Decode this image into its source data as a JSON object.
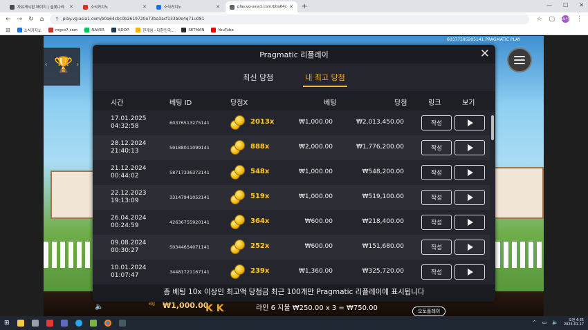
{
  "browser": {
    "tabs": [
      {
        "title": "자유게시판 페이지 | 슬롯나라",
        "color": "#4a4a4a",
        "active": false
      },
      {
        "title": "소식카지노",
        "color": "#d93025",
        "active": false
      },
      {
        "title": "소식카지노",
        "color": "#1a73e8",
        "active": false
      },
      {
        "title": "play.vg-asia1.com/b0a64c",
        "color": "#5f6368",
        "active": true
      }
    ],
    "new_tab": "+",
    "url": "play.vg-asia1.com/b0a64cbc0b2619720e73ba3acf133b0e4q71u081",
    "profile": "소식",
    "bookmarks": [
      {
        "label": "소식카지노",
        "color": "#1a73e8"
      },
      {
        "label": "mgco7.com",
        "color": "#c0392b"
      },
      {
        "label": "NAVER",
        "color": "#03c75a"
      },
      {
        "label": "SDOP",
        "color": "#1b3a57"
      },
      {
        "label": "한게임 - 대한민국...",
        "color": "#f4b400"
      },
      {
        "label": "SETMAN",
        "color": "#2d2d2d"
      },
      {
        "label": "YouTube",
        "color": "#ff0000"
      }
    ]
  },
  "game": {
    "id_text": "60377595205141  PRAGMATIC PLAY",
    "bet_label": "베팅",
    "bet_value": "₩1,000.00",
    "kk": "K K",
    "line_info": "라인 6 지불 ₩250.00 x 3 = ₩750.00",
    "autoplay": "오토플레이"
  },
  "panel": {
    "title": "Pragmatic 리플레이",
    "close": "✕",
    "tabs": [
      {
        "label": "최신 당첨",
        "active": false
      },
      {
        "label": "내 최고 당첨",
        "active": true
      }
    ],
    "columns": {
      "time": "시간",
      "bet_id": "베팅 ID",
      "multiplier": "당첨X",
      "bet": "베팅",
      "win": "당첨",
      "link": "링크",
      "view": "보기"
    },
    "rows": [
      {
        "date": "17.01.2025",
        "time": "04:32:58",
        "bet_id": "60376513275141",
        "multiplier": "2013x",
        "bet": "₩1,000.00",
        "win": "₩2,013,450.00",
        "link_label": "작성"
      },
      {
        "date": "28.12.2024",
        "time": "21:40:13",
        "bet_id": "59188011099141",
        "multiplier": "888x",
        "bet": "₩2,000.00",
        "win": "₩1,776,200.00",
        "link_label": "작성"
      },
      {
        "date": "21.12.2024",
        "time": "00:44:02",
        "bet_id": "58717336372141",
        "multiplier": "548x",
        "bet": "₩1,000.00",
        "win": "₩548,200.00",
        "link_label": "작성"
      },
      {
        "date": "22.12.2023",
        "time": "19:13:09",
        "bet_id": "33147941052141",
        "multiplier": "519x",
        "bet": "₩1,000.00",
        "win": "₩519,100.00",
        "link_label": "작성"
      },
      {
        "date": "26.04.2024",
        "time": "00:24:59",
        "bet_id": "42636755920141",
        "multiplier": "364x",
        "bet": "₩600.00",
        "win": "₩218,400.00",
        "link_label": "작성"
      },
      {
        "date": "09.08.2024",
        "time": "00:30:27",
        "bet_id": "50344654071141",
        "multiplier": "252x",
        "bet": "₩600.00",
        "win": "₩151,680.00",
        "link_label": "작성"
      },
      {
        "date": "10.01.2024",
        "time": "01:07:47",
        "bet_id": "34481721167141",
        "multiplier": "239x",
        "bet": "₩1,360.00",
        "win": "₩325,720.00",
        "link_label": "작성"
      }
    ],
    "footnote": "총 베팅 10x 이상인 최고액 당첨금 최근 100개만 Pragmatic 리플레이에 표시됩니다"
  },
  "taskbar": {
    "clock_time": "오전 4:35",
    "clock_date": "2025-01-17"
  }
}
